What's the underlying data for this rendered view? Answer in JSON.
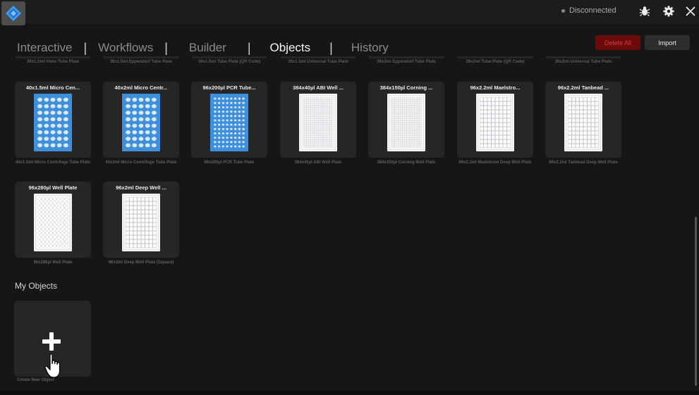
{
  "header": {
    "status_text": "Disconnected",
    "icons": [
      "app-logo-icon",
      "bug-icon",
      "gear-icon",
      "close-icon"
    ]
  },
  "nav": {
    "tabs": [
      {
        "label": "Interactive",
        "active": false
      },
      {
        "label": "Workflows",
        "active": false
      },
      {
        "label": "Builder",
        "active": false
      },
      {
        "label": "Objects",
        "active": true
      },
      {
        "label": "History",
        "active": false
      }
    ]
  },
  "actions": {
    "delete_all": "Delete All",
    "import": "Import"
  },
  "previous_row_captions": [
    "39x1.5ml Vwex Tube Plate",
    "39x1.5ml Eppendorf Tube Plate",
    "39x1.5ml Tube Plate (QR Code)",
    "39x1.5ml Universal Tube Plate",
    "39x2ml Eppendorf Tube Plate",
    "39x2ml Tube Plate (QR Code)",
    "39x2ml Universal Tube Plate"
  ],
  "objects": [
    {
      "title": "40x1.5ml Micro Cen...",
      "caption": "40x1.5ml Micro Centrifuge Tube Plate",
      "plate": "blue-tubes"
    },
    {
      "title": "40x2ml Micro Centr...",
      "caption": "40x2ml Micro Centrifuge Tube Plate",
      "plate": "blue-tubes"
    },
    {
      "title": "96x200µl PCR Tube...",
      "caption": "96x200µl PCR Tube Plate",
      "plate": "blue-pcr"
    },
    {
      "title": "384x40µl ABI Well ...",
      "caption": "384x40µl ABI Well Plate",
      "plate": "white-384"
    },
    {
      "title": "384x150µl Corning ...",
      "caption": "384x150µl Corning Well Plate",
      "plate": "white-384"
    },
    {
      "title": "96x2.2ml Maelstro...",
      "caption": "96x2.2ml Maelstrom Deep Well Plate",
      "plate": "white-deep"
    },
    {
      "title": "96x2.2ml Tanbead ...",
      "caption": "96x2.2ml Tanbead Deep Well Plate",
      "plate": "white-deep"
    },
    {
      "title": "96x280µl Well Plate",
      "caption": "96x280µl Well Plate",
      "plate": "white-96"
    },
    {
      "title": "96x2ml Deep Well ...",
      "caption": "96x2ml Deep Well Plate (Square)",
      "plate": "white-deep"
    }
  ],
  "my_objects": {
    "title": "My Objects",
    "add_caption": "Create New Object",
    "icons": [
      "plus-icon",
      "hand-pointer-icon"
    ]
  },
  "colors": {
    "accent_blue": "#3e8fdc",
    "delete_bg": "#6a0a0a",
    "delete_text": "#d63b3b"
  }
}
